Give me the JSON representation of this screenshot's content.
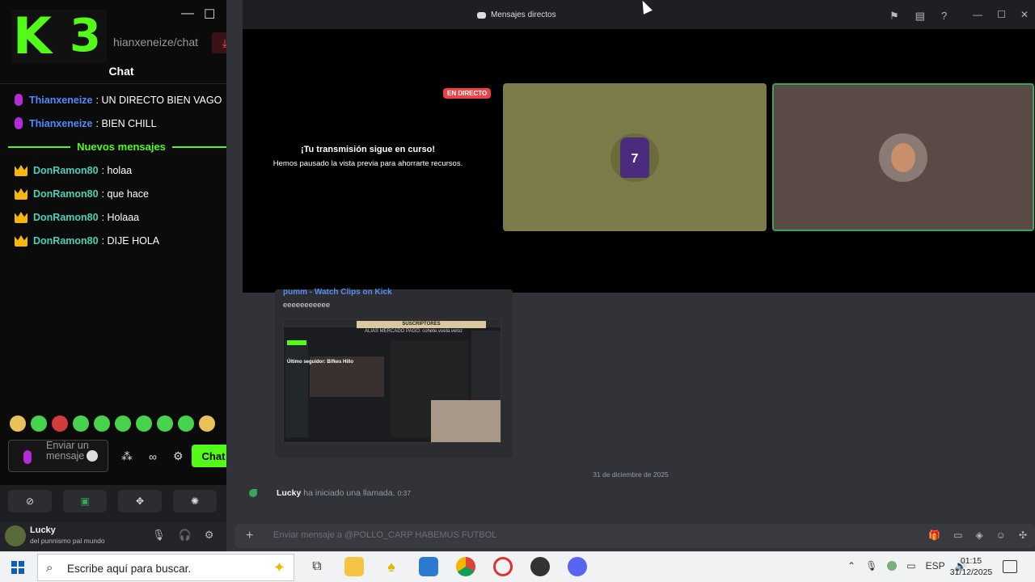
{
  "kick": {
    "url": "hianxeneize/chat",
    "chat_title": "Chat",
    "messages_top": [
      {
        "user": "Thianxeneize",
        "text": ": UN DIRECTO BIEN VAGO"
      },
      {
        "user": "Thianxeneize",
        "text": ": BIEN CHILL"
      }
    ],
    "nuevos_label": "Nuevos mensajes",
    "messages_new": [
      {
        "user": "DonRamon80",
        "text": ": holaa"
      },
      {
        "user": "DonRamon80",
        "text": ": que hace"
      },
      {
        "user": "DonRamon80",
        "text": ": Holaaa"
      },
      {
        "user": "DonRamon80",
        "text": ": DIJE HOLA"
      }
    ],
    "input_placeholder": "Enviar un mensaje",
    "send_label": "Chat",
    "brand_color": "#53fc18"
  },
  "discord": {
    "window_title": "Mensajes directos",
    "stream": {
      "live_badge": "EN DIRECTO",
      "paused_title": "¡Tu transmisión sigue en curso!",
      "paused_sub": "Hemos pausado la vista previa para ahorrarte recursos.",
      "player_number": "7"
    },
    "embed": {
      "title": "pumm - Watch Clips on Kick",
      "text": "eeeeeeeeeee",
      "shot_subs": "SUSCRIPTORES",
      "shot_alias": "ALIAS MERCADO PAGO: cohete.vuela.veloz",
      "shot_label": "Último seguidor: Bifkes Hillo"
    },
    "date_separator": "31 de diciembre de 2025",
    "call": {
      "user": "Lucky",
      "text": "ha iniciado una llamada.",
      "duration": "0:37"
    },
    "composer_placeholder": "Enviar mensaje a @POLLO_CARP HABEMUS FUTBOL",
    "user": {
      "name": "Lucky",
      "status": "del punnismo pal mundo"
    }
  },
  "taskbar": {
    "search_placeholder": "Escribe aquí para buscar.",
    "lang": "ESP",
    "time": "01:15",
    "date": "31/12/2025"
  }
}
